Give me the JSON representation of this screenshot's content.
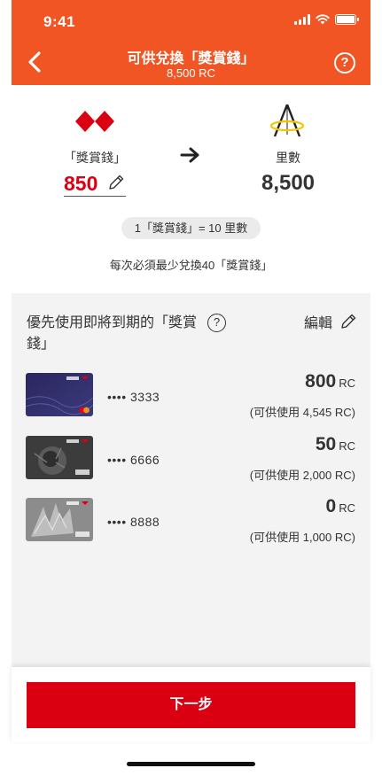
{
  "status_bar": {
    "time": "9:41"
  },
  "header": {
    "title": "可供兌換「獎賞錢」",
    "subtitle": "8,500 RC",
    "help_symbol": "?"
  },
  "conversion": {
    "from_label": "「獎賞錢」",
    "from_value": "850",
    "to_label": "里數",
    "to_value": "8,500",
    "rate_text": "1「獎賞錢」= 10 里數",
    "min_note": "每次必須最少兌換40「獎賞錢」"
  },
  "panel": {
    "title": "優先使用即將到期的「獎賞錢」",
    "help_symbol": "?",
    "edit_label": "編輯",
    "cards": [
      {
        "masked_number": "•••• 3333",
        "rc_value": "800",
        "rc_unit": "RC",
        "available": "(可供使用 4,545 RC)",
        "network": "mastercard"
      },
      {
        "masked_number": "•••• 6666",
        "rc_value": "50",
        "rc_unit": "RC",
        "available": "(可供使用 2,000 RC)",
        "network": "VISA"
      },
      {
        "masked_number": "•••• 8888",
        "rc_value": "0",
        "rc_unit": "RC",
        "available": "(可供使用 1,000 RC)",
        "network": "VISA"
      }
    ]
  },
  "footer": {
    "next_label": "下一步"
  },
  "colors": {
    "header_bg": "#f05523",
    "accent_red": "#db0011",
    "panel_bg": "#f3f3f3"
  },
  "icons": [
    "back-icon",
    "help-icon",
    "hsbc-logo",
    "asia-miles-logo",
    "arrow-right-icon",
    "pencil-icon"
  ]
}
